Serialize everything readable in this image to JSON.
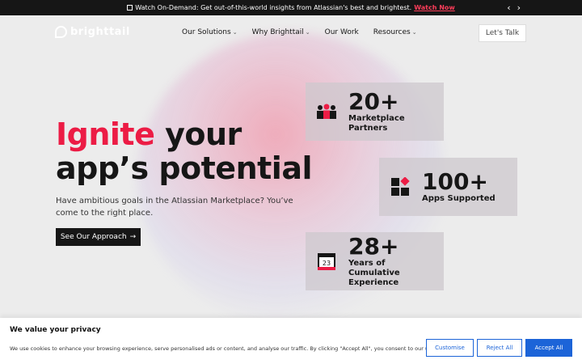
{
  "topbar": {
    "icon": "play-icon",
    "text": "Watch On-Demand: Get out-of-this-world insights from Atlassian's best and brightest.",
    "link": "Watch Now",
    "prev": "‹",
    "next": "›"
  },
  "nav": {
    "logo": "brighttail",
    "items": [
      {
        "label": "Our Solutions",
        "dropdown": true
      },
      {
        "label": "Why Brighttail",
        "dropdown": true
      },
      {
        "label": "Our Work",
        "dropdown": false
      },
      {
        "label": "Resources",
        "dropdown": true
      }
    ],
    "cta": "Let's Talk"
  },
  "hero": {
    "title_accent": "Ignite",
    "title_rest1": " your",
    "title_line2": "app’s potential",
    "subtitle": "Have ambitious goals in the Atlassian Marketplace? You’ve come to the right place.",
    "button": "See Our Approach",
    "button_arrow": "→"
  },
  "stats": [
    {
      "number": "20+",
      "label_lines": [
        "Marketplace",
        "Partners"
      ],
      "icon": "people-icon"
    },
    {
      "number": "100+",
      "label_lines": [
        "Apps Supported"
      ],
      "icon": "blocks-icon"
    },
    {
      "number": "28+",
      "label_lines": [
        "Years of",
        "Cumulative",
        "Experience"
      ],
      "icon": "calendar-icon",
      "calendar_day": "23"
    }
  ],
  "cookie": {
    "title": "We value your privacy",
    "text": "We use cookies to enhance your browsing experience, serve personalised ads or content, and analyse our traffic. By clicking \"Accept All\", you consent to our use of cookies.",
    "customise": "Customise",
    "reject": "Reject All",
    "accept": "Accept All"
  },
  "colors": {
    "accent": "#ec1c45",
    "dark": "#161616",
    "cookie_blue": "#1c64d8"
  }
}
